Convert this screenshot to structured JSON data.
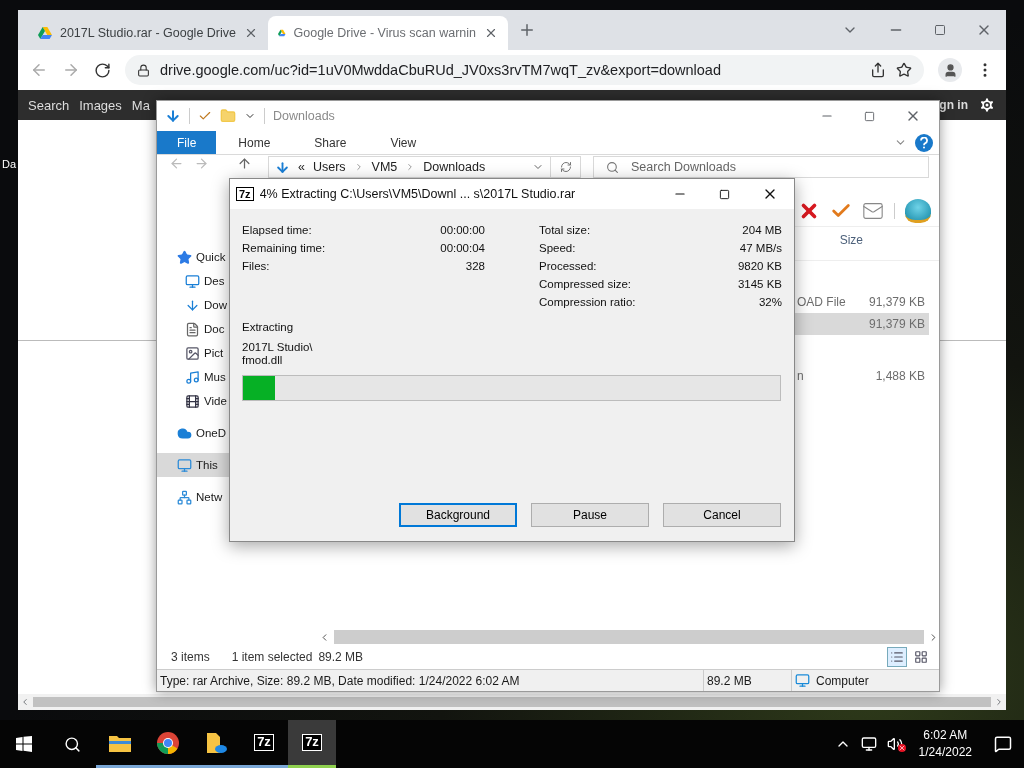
{
  "desktop": {
    "icon_label": "Da"
  },
  "browser": {
    "tabs": [
      {
        "title": "2017L Studio.rar - Google Drive",
        "selected": false
      },
      {
        "title": "Google Drive - Virus scan warnin",
        "selected": true
      }
    ],
    "address": "drive.google.com/uc?id=1uV0MwddaCbuRUd_JV0xs3rvTM7wqT_zv&export=download",
    "page_nav": {
      "links": [
        "Search",
        "Images",
        "Ma"
      ],
      "sign_in": "gn in"
    }
  },
  "explorer": {
    "title": "Downloads",
    "ribbon_tabs": [
      {
        "label": "File",
        "selected": true
      },
      {
        "label": "Home",
        "selected": false
      },
      {
        "label": "Share",
        "selected": false
      },
      {
        "label": "View",
        "selected": false
      }
    ],
    "breadcrumb": [
      "«",
      "Users",
      "VM5",
      "Downloads"
    ],
    "search": {
      "placeholder": "Search Downloads"
    },
    "nav": [
      {
        "label": "Quick",
        "kind": "quick",
        "selected": false
      },
      {
        "label": "Des",
        "kind": "desktop",
        "selected": false
      },
      {
        "label": "Dow",
        "kind": "downloads",
        "selected": false
      },
      {
        "label": "Doc",
        "kind": "documents",
        "selected": false
      },
      {
        "label": "Pict",
        "kind": "pictures",
        "selected": false
      },
      {
        "label": "Mus",
        "kind": "music",
        "selected": false
      },
      {
        "label": "Vide",
        "kind": "videos",
        "selected": false
      },
      {
        "label": "OneD",
        "kind": "onedrive",
        "selected": false
      },
      {
        "label": "This",
        "kind": "pc",
        "selected": true
      },
      {
        "label": "Netw",
        "kind": "network",
        "selected": false
      }
    ],
    "column_header": "Size",
    "rows": [
      {
        "type": "OAD File",
        "size": "91,379 KB",
        "selected": false
      },
      {
        "size": "91,379 KB",
        "selected": true
      },
      {
        "type": "n",
        "size": "1,488 KB",
        "selected": false
      }
    ],
    "status": {
      "count": "3 items",
      "selection": "1 item selected",
      "selection_size": "89.2 MB"
    },
    "details_bar": {
      "description": "Type: rar Archive, Size: 89.2 MB, Date modified: 1/24/2022 6:02 AM",
      "size": "89.2 MB",
      "location": "Computer"
    }
  },
  "dialog": {
    "icon_text": "7z",
    "title": "4% Extracting C:\\Users\\VM5\\Downl ... s\\2017L Studio.rar",
    "stats_left": [
      {
        "label": "Elapsed time:",
        "value": "00:00:00"
      },
      {
        "label": "Remaining time:",
        "value": "00:00:04"
      },
      {
        "label": "Files:",
        "value": "328"
      }
    ],
    "stats_right": [
      {
        "label": "Total size:",
        "value": "204 MB"
      },
      {
        "label": "Speed:",
        "value": "47 MB/s"
      },
      {
        "label": "Processed:",
        "value": "9820 KB"
      },
      {
        "label": "Compressed size:",
        "value": "3145 KB"
      },
      {
        "label": "Compression ratio:",
        "value": "32%"
      }
    ],
    "operation": "Extracting",
    "current_file": [
      "2017L Studio\\",
      "fmod.dll"
    ],
    "progress": {
      "level": 0.06
    },
    "buttons": [
      {
        "label": "Background",
        "focused": true
      },
      {
        "label": "Pause",
        "focused": false
      },
      {
        "label": "Cancel",
        "focused": false
      }
    ]
  },
  "taskbar": {
    "apps": [
      {
        "kind": "explorer",
        "active": false
      },
      {
        "kind": "chrome",
        "active": false
      },
      {
        "kind": "files",
        "active": false
      },
      {
        "kind": "sevenzip",
        "active": false,
        "icon_text": "7z"
      },
      {
        "kind": "sevenzip",
        "active": true,
        "icon_text": "7z"
      }
    ],
    "time": "6:02 AM",
    "date": "1/24/2022"
  }
}
